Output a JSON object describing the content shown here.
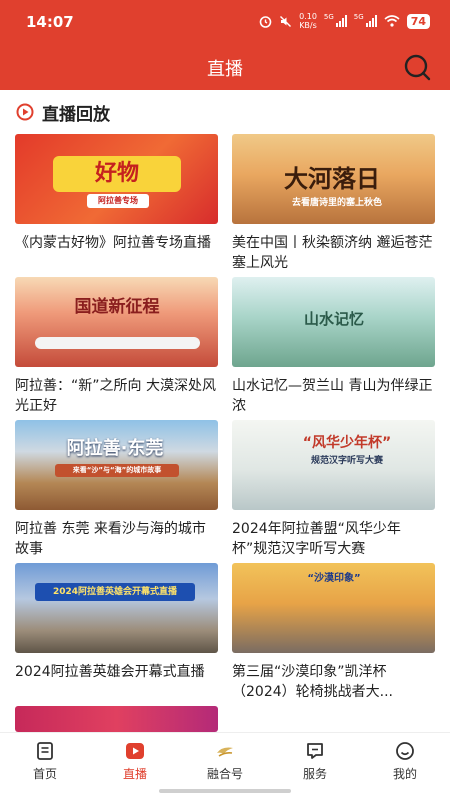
{
  "status_bar": {
    "time": "14:07",
    "net_speed": "0.10",
    "net_unit": "KB/s",
    "signal_label_1": "5G",
    "signal_label_2": "5G",
    "battery": "74"
  },
  "header": {
    "title": "直播",
    "accent_color": "#e0402e"
  },
  "section": {
    "title": "直播回放"
  },
  "cards": [
    {
      "title": "《内蒙古好物》阿拉善专场直播",
      "thumb_text": "好物",
      "thumb_sub": "阿拉善专场"
    },
    {
      "title": "美在中国丨秋染额济纳 邂逅苍茫塞上风光",
      "thumb_text": "大河落日",
      "thumb_sub": "去看唐诗里的塞上秋色"
    },
    {
      "title": "  阿拉善：“新”之所向  大漠深处风光正好",
      "thumb_text": "国道新征程",
      "thumb_sub": ""
    },
    {
      "title": "山水记忆—贺兰山  青山为伴绿正浓",
      "thumb_text": "山水记忆",
      "thumb_sub": ""
    },
    {
      "title": "阿拉善    东莞  来看沙与海的城市故事",
      "thumb_text": "阿拉善·东莞",
      "thumb_sub": "来看“沙”与“海”的城市故事"
    },
    {
      "title": "2024年阿拉善盟“风华少年杯”规范汉字听写大赛",
      "thumb_text": "“风华少年杯”",
      "thumb_sub": "规范汉字听写大赛"
    },
    {
      "title": "2024阿拉善英雄会开幕式直播",
      "thumb_text": "2024阿拉善英雄会开幕式直播",
      "thumb_sub": ""
    },
    {
      "title": "第三届“沙漠印象”凯洋杯（2024）轮椅挑战者大...",
      "thumb_text": "“沙漠印象”",
      "thumb_sub": ""
    },
    {
      "title": "",
      "thumb_text": "",
      "thumb_sub": ""
    }
  ],
  "tabs": [
    {
      "label": "首页",
      "icon": "home-icon",
      "active": false
    },
    {
      "label": "直播",
      "icon": "live-play-icon",
      "active": true
    },
    {
      "label": "融合号",
      "icon": "fusion-icon",
      "active": false
    },
    {
      "label": "服务",
      "icon": "service-icon",
      "active": false
    },
    {
      "label": "我的",
      "icon": "profile-icon",
      "active": false
    }
  ]
}
